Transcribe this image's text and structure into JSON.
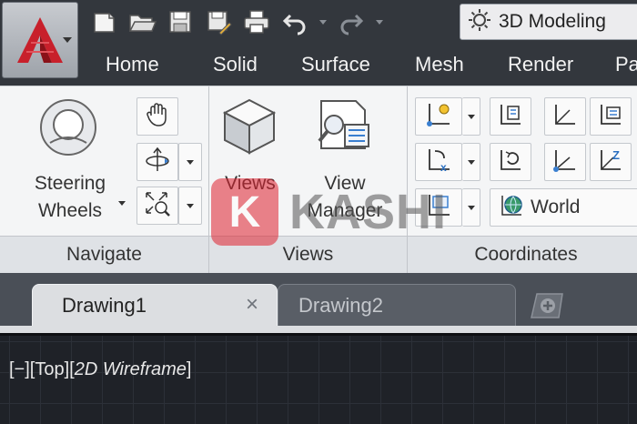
{
  "workspace": {
    "name": "3D Modeling"
  },
  "ribbon_tabs": [
    "Home",
    "Solid",
    "Surface",
    "Mesh",
    "Render",
    "Pa"
  ],
  "panels": {
    "navigate": {
      "title": "Navigate",
      "steering_wheels": {
        "line1": "Steering",
        "line2": "Wheels"
      }
    },
    "views": {
      "title": "Views",
      "views_label": "Views",
      "view_manager": {
        "line1": "View",
        "line2": "Manager"
      }
    },
    "coordinates": {
      "title": "Coordinates",
      "ucs_world": "World"
    }
  },
  "watermark": {
    "letter": "K",
    "word": "KASHI"
  },
  "documents": {
    "tabs": [
      {
        "label": "Drawing1",
        "active": true
      },
      {
        "label": "Drawing2",
        "active": false
      }
    ],
    "close_glyph": "×"
  },
  "viewport": {
    "prefix": "[−][Top][",
    "style": "2D Wireframe",
    "suffix": "]"
  },
  "colors": {
    "titlebar": "#33373d",
    "ribbon_bg": "#f4f5f6",
    "panel_title_bg": "#dfe2e6",
    "drawing_bg": "#1f2228",
    "autocad_red": "#c8202b"
  }
}
